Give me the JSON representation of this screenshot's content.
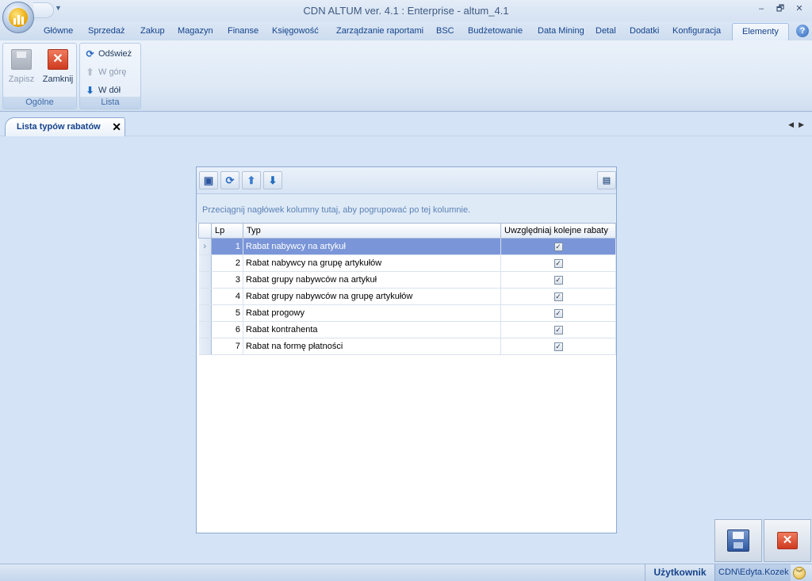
{
  "window": {
    "title": "CDN ALTUM ver. 4.1 : Enterprise - altum_4.1",
    "minimize": "–",
    "restore": "🗗",
    "close": "✕"
  },
  "ribbon_tabs": [
    "Główne",
    "Sprzedaż",
    "Zakup",
    "Magazyn",
    "Finanse",
    "Księgowość",
    "Zarządzanie raportami",
    "BSC",
    "Budżetowanie",
    "Data Mining",
    "Detal",
    "Dodatki",
    "Konfiguracja",
    "Elementy"
  ],
  "active_tab": "Elementy",
  "help_label": "?",
  "groups": {
    "ogolne": {
      "label": "Ogólne",
      "save": "Zapisz",
      "close": "Zamknij"
    },
    "lista": {
      "label": "Lista",
      "refresh": "Odśwież",
      "up": "W górę",
      "down": "W dół"
    }
  },
  "doc_tab": {
    "title": "Lista typów rabatów",
    "close": "✕"
  },
  "grid": {
    "group_hint": "Przeciągnij nagłówek kolumny tutaj, aby pogrupować po tej kolumnie.",
    "columns": [
      "Lp",
      "Typ",
      "Uwzględniaj kolejne rabaty"
    ],
    "rows": [
      {
        "lp": "1",
        "typ": "Rabat nabywcy na artykuł",
        "checked": true
      },
      {
        "lp": "2",
        "typ": "Rabat nabywcy na grupę artykułów",
        "checked": true
      },
      {
        "lp": "3",
        "typ": "Rabat grupy nabywców na artykuł",
        "checked": true
      },
      {
        "lp": "4",
        "typ": "Rabat grupy nabywców na grupę artykułów",
        "checked": true
      },
      {
        "lp": "5",
        "typ": "Rabat progowy",
        "checked": true
      },
      {
        "lp": "6",
        "typ": "Rabat kontrahenta",
        "checked": true
      },
      {
        "lp": "7",
        "typ": "Rabat na formę płatności",
        "checked": true
      }
    ],
    "selected_row": 0
  },
  "status": {
    "user_label": "Użytkownik",
    "user_value": "CDN\\Edyta.Kozek"
  },
  "colors": {
    "selection": "#7a96d8",
    "background": "#d4e3f5",
    "accent": "#15428b"
  }
}
